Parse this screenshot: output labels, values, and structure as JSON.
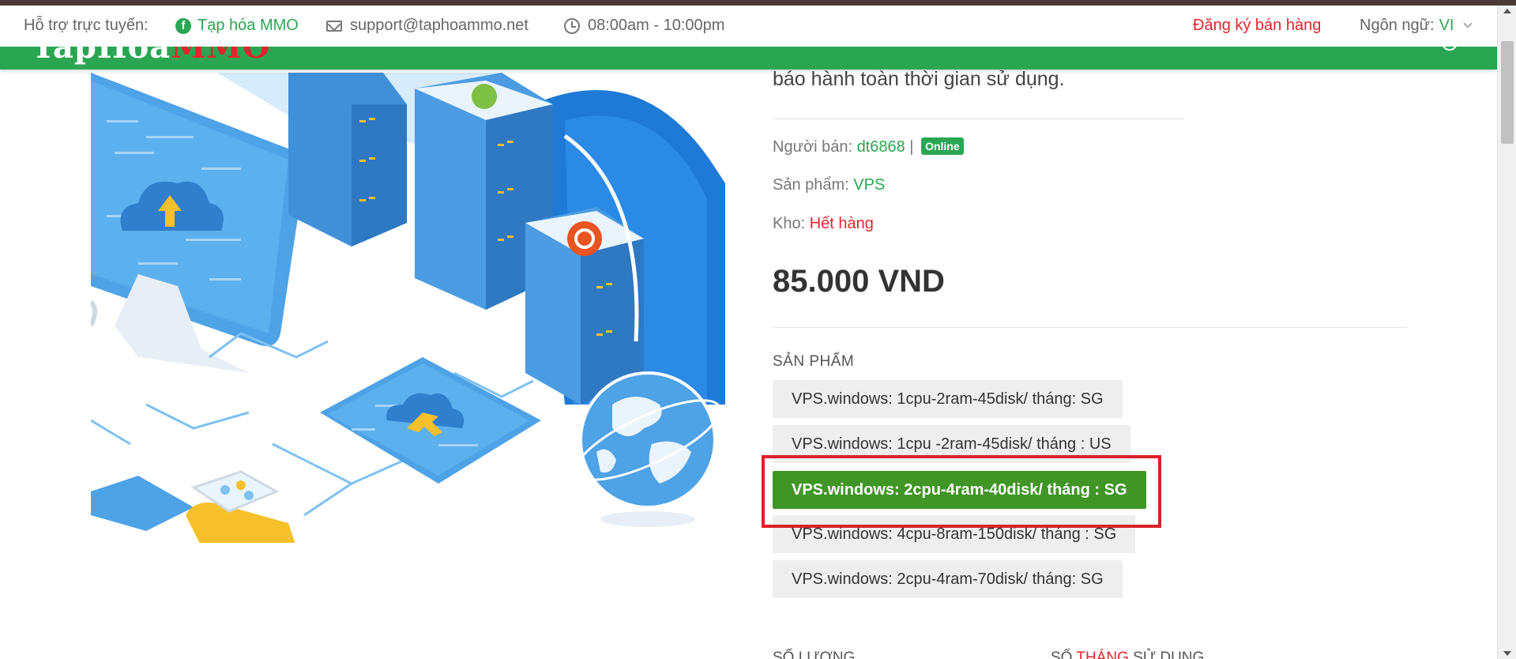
{
  "support_bar": {
    "label": "Hỗ trợ trực tuyến:",
    "facebook": "Tạp hóa MMO",
    "email": "support@taphoammo.net",
    "hours": "08:00am - 10:00pm",
    "register": "Đăng ký bán hàng",
    "language_label": "Ngôn ngữ:",
    "language_value": "VI"
  },
  "header": {
    "logo_main": "TapHoa",
    "logo_accent": "MMO"
  },
  "product": {
    "description_tail": "báo hành toàn thời gian sử dụng.",
    "seller_label": "Người bán:",
    "seller_name": "dt6868",
    "seller_sep": "|",
    "seller_status": "Online",
    "type_label": "Sản phẩm:",
    "type_value": "VPS",
    "stock_label": "Kho:",
    "stock_value": "Hết hàng",
    "price": "85.000 VND",
    "section_label": "SẢN PHẨM",
    "variants": [
      {
        "label": "VPS.windows: 1cpu-2ram-45disk/ tháng: SG",
        "selected": false
      },
      {
        "label": "VPS.windows: 1cpu -2ram-45disk/ tháng : US",
        "selected": false
      },
      {
        "label": "VPS.windows: 2cpu-4ram-40disk/ tháng : SG",
        "selected": true
      },
      {
        "label": "VPS.windows: 4cpu-8ram-150disk/ tháng : SG",
        "selected": false
      },
      {
        "label": "VPS.windows: 2cpu-4ram-70disk/ tháng: SG",
        "selected": false
      }
    ],
    "quantity_label": "SỐ LƯỢNG",
    "months_label_a": "SỐ",
    "months_label_b": "THÁNG",
    "months_label_c": "SỬ DỤNG"
  },
  "colors": {
    "brand_green": "#2aa653",
    "selected_green": "#3f9624",
    "alert_red": "#e0252e",
    "highlight_red": "#d9222a"
  },
  "icons": [
    "facebook-icon",
    "mail-icon",
    "clock-icon",
    "chevron-down-icon",
    "user-icon"
  ]
}
